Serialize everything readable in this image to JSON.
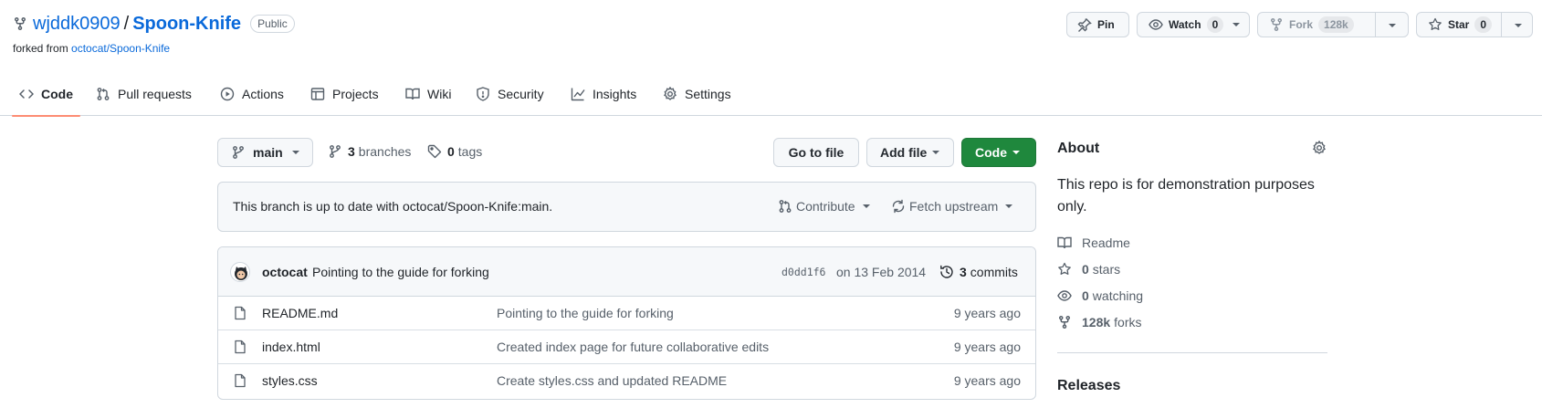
{
  "repo": {
    "owner": "wjddk0909",
    "separator": "/",
    "name": "Spoon-Knife",
    "visibility": "Public",
    "forked_prefix": "forked from",
    "forked_source": "octocat/Spoon-Knife"
  },
  "actions": {
    "pin_label": "Pin",
    "watch_label": "Watch",
    "watch_count": "0",
    "fork_label": "Fork",
    "fork_count": "128k",
    "star_label": "Star",
    "star_count": "0"
  },
  "tabs": [
    {
      "label": "Code",
      "icon": "code-icon",
      "active": true
    },
    {
      "label": "Pull requests",
      "icon": "pull-request-icon"
    },
    {
      "label": "Actions",
      "icon": "play-icon"
    },
    {
      "label": "Projects",
      "icon": "table-icon"
    },
    {
      "label": "Wiki",
      "icon": "book-icon"
    },
    {
      "label": "Security",
      "icon": "shield-icon"
    },
    {
      "label": "Insights",
      "icon": "graph-icon"
    },
    {
      "label": "Settings",
      "icon": "gear-icon"
    }
  ],
  "toolbar": {
    "branch": "main",
    "branches_count": "3",
    "branches_label": "branches",
    "tags_count": "0",
    "tags_label": "tags",
    "go_to_file": "Go to file",
    "add_file": "Add file",
    "code": "Code"
  },
  "upstream": {
    "message": "This branch is up to date with octocat/Spoon-Knife:main.",
    "contribute": "Contribute",
    "fetch": "Fetch upstream"
  },
  "latest_commit": {
    "author": "octocat",
    "message": "Pointing to the guide for forking",
    "sha": "d0dd1f6",
    "date": "on 13 Feb 2014",
    "commits_count": "3",
    "commits_label": "commits"
  },
  "files": [
    {
      "name": "README.md",
      "message": "Pointing to the guide for forking",
      "age": "9 years ago"
    },
    {
      "name": "index.html",
      "message": "Created index page for future collaborative edits",
      "age": "9 years ago"
    },
    {
      "name": "styles.css",
      "message": "Create styles.css and updated README",
      "age": "9 years ago"
    }
  ],
  "about": {
    "title": "About",
    "description": "This repo is for demonstration purposes only.",
    "readme": "Readme",
    "stars_count": "0",
    "stars_label": "stars",
    "watching_count": "0",
    "watching_label": "watching",
    "forks_count": "128k",
    "forks_label": "forks",
    "releases_title": "Releases"
  },
  "colors": {
    "link": "#0969da",
    "primary_button": "#1f883d",
    "active_tab_underline": "#fd8c73"
  }
}
